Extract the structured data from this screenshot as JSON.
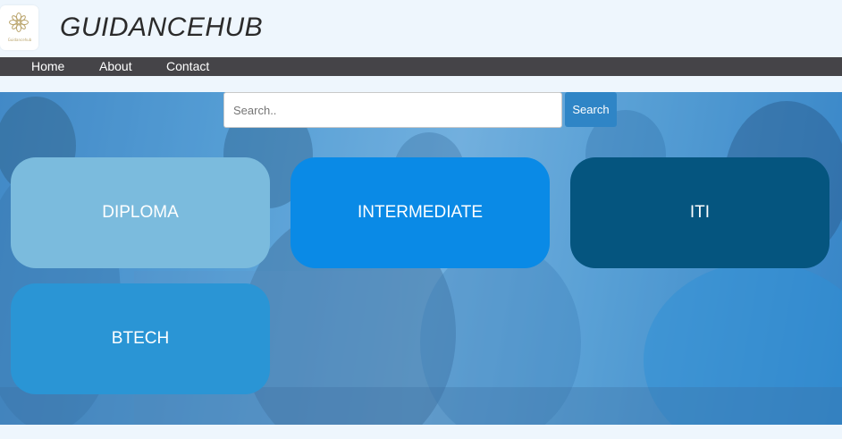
{
  "header": {
    "title": "GUIDANCEHUB",
    "logo_text": "Guidancehub"
  },
  "nav": {
    "items": [
      {
        "label": "Home"
      },
      {
        "label": "About"
      },
      {
        "label": "Contact"
      }
    ]
  },
  "search": {
    "placeholder": "Search..",
    "value": "",
    "button_label": "Search"
  },
  "cards": [
    {
      "label": "DIPLOMA",
      "color": "#7bbbdd"
    },
    {
      "label": "INTERMEDIATE",
      "color": "#0a8ae6"
    },
    {
      "label": "ITI",
      "color": "#05557f"
    },
    {
      "label": "BTECH",
      "color": "#2a95d5"
    }
  ],
  "colors": {
    "nav_bg": "#454448",
    "page_bg": "#eef6fd",
    "search_button": "#2f85c6"
  }
}
